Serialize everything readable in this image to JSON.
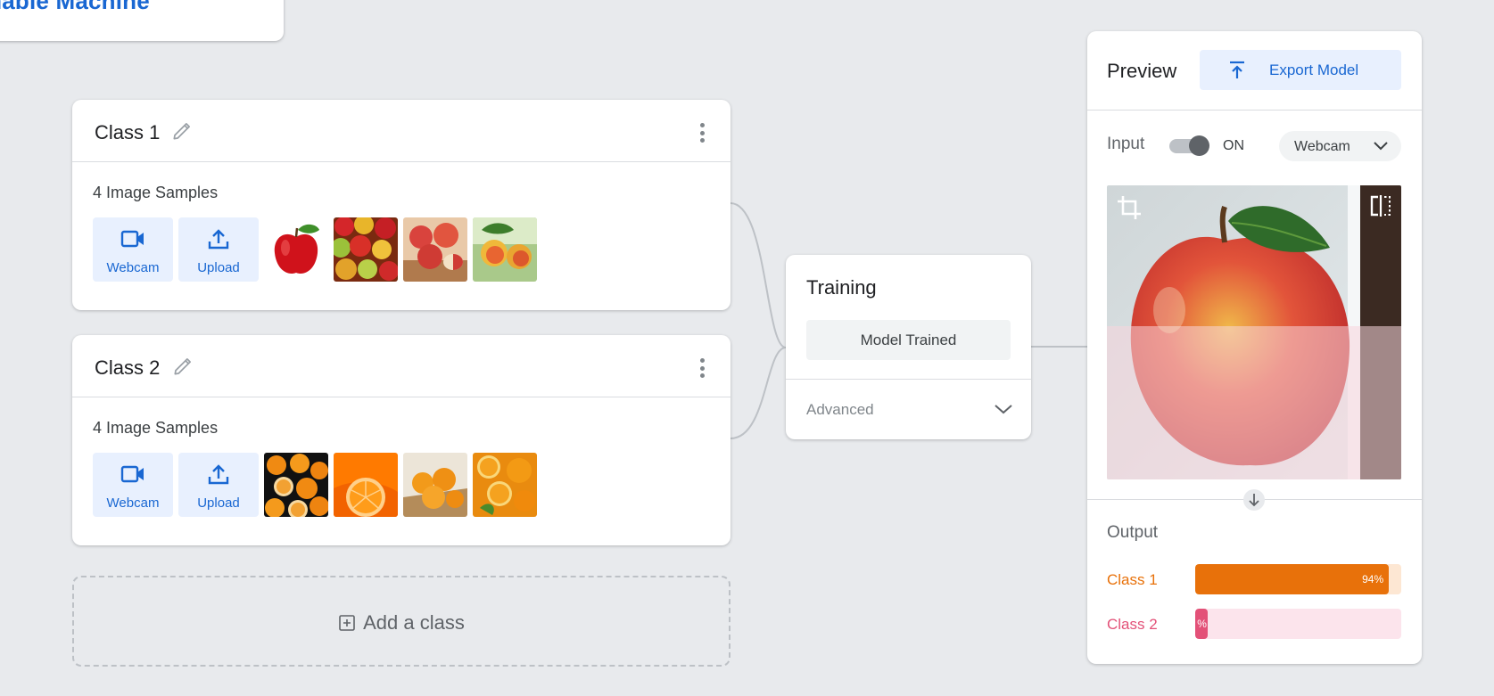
{
  "app": {
    "logo_text": "Teachable Machine"
  },
  "classes": [
    {
      "title": "Class 1",
      "samples_text": "4 Image Samples",
      "webcam_label": "Webcam",
      "upload_label": "Upload",
      "thumbnails": [
        "single-red-apple",
        "pile-of-apples",
        "red-apples-on-table",
        "apples-on-branch"
      ]
    },
    {
      "title": "Class 2",
      "samples_text": "4 Image Samples",
      "webcam_label": "Webcam",
      "upload_label": "Upload",
      "thumbnails": [
        "oranges-dark-background",
        "orange-slice-splash",
        "oranges-in-bag",
        "sliced-oranges-leaves"
      ]
    }
  ],
  "add_class_label": "Add a class",
  "training": {
    "title": "Training",
    "status_button": "Model Trained",
    "advanced_label": "Advanced"
  },
  "preview": {
    "title": "Preview",
    "export_label": "Export Model",
    "input_label": "Input",
    "toggle_state": "ON",
    "source_select": "Webcam",
    "output_label": "Output",
    "outputs": [
      {
        "name": "Class 1",
        "percent_text": "94%",
        "value": 0.94,
        "color": "#e8710a",
        "track": "#fde7d3"
      },
      {
        "name": "Class 2",
        "percent_text": "%",
        "value": 0.06,
        "color": "#e35178",
        "track": "#fce4ec"
      }
    ]
  },
  "colors": {
    "accent": "#1967d2",
    "accent_bg": "#e8f0fe",
    "background": "#e8eaed"
  }
}
